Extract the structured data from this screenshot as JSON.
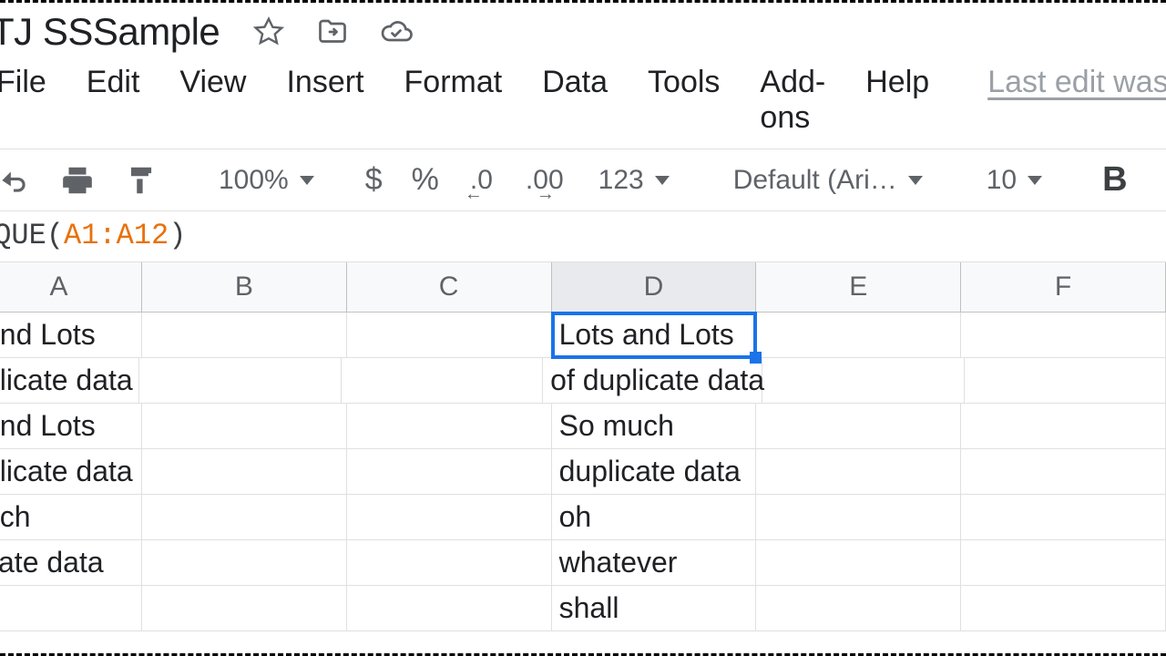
{
  "title": "TJ SSSample",
  "menus": [
    "File",
    "Edit",
    "View",
    "Insert",
    "Format",
    "Data",
    "Tools",
    "Add-ons",
    "Help"
  ],
  "last_edit": "Last edit was se",
  "toolbar": {
    "zoom": "100%",
    "font": "Default (Ari…",
    "font_size": "10",
    "number_format": "123"
  },
  "formula": {
    "prefix": "IQUE(",
    "ref": "A1:A12",
    "suffix": ")"
  },
  "columns": [
    "A",
    "B",
    "C",
    "D",
    "E",
    "F"
  ],
  "selected_col": "D",
  "rows": [
    {
      "A": " and Lots",
      "D": "Lots and Lots",
      "selected": "D"
    },
    {
      "A": "plicate data",
      "D": "of duplicate data"
    },
    {
      "A": " and Lots",
      "D": "So much"
    },
    {
      "A": "plicate data",
      "D": "duplicate data"
    },
    {
      "A": "uch",
      "D": "oh"
    },
    {
      "A": "cate data",
      "D": "whatever"
    },
    {
      "A": "",
      "D": "shall"
    }
  ]
}
